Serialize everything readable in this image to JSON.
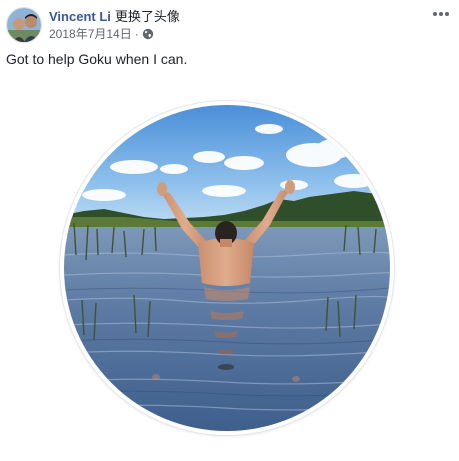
{
  "post": {
    "author": {
      "name": "Vincent Li",
      "action": "更换了头像"
    },
    "meta": {
      "date": "2018年7月14日",
      "separator": "·",
      "privacy_icon": "globe-icon"
    },
    "menu_icon": "more-horizontal-icon",
    "text": "Got to help Goku when I can."
  },
  "colors": {
    "author_name": "#385898",
    "meta_text": "#616770",
    "body_text": "#1d2129",
    "frame_border": "#e4e6ea"
  }
}
